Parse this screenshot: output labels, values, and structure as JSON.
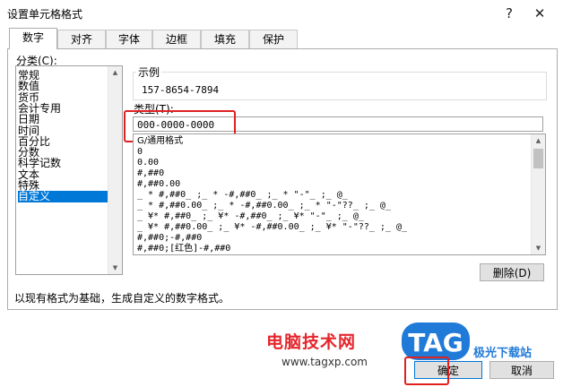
{
  "window": {
    "title": "设置单元格格式",
    "help_symbol": "?",
    "close_symbol": "✕"
  },
  "tabs": [
    {
      "label": "数字",
      "active": true
    },
    {
      "label": "对齐",
      "active": false
    },
    {
      "label": "字体",
      "active": false
    },
    {
      "label": "边框",
      "active": false
    },
    {
      "label": "填充",
      "active": false
    },
    {
      "label": "保护",
      "active": false
    }
  ],
  "category": {
    "label": "分类(C):",
    "items": [
      "常规",
      "数值",
      "货币",
      "会计专用",
      "日期",
      "时间",
      "百分比",
      "分数",
      "科学记数",
      "文本",
      "特殊",
      "自定义"
    ],
    "selected": "自定义"
  },
  "sample": {
    "label": "示例",
    "value": "157-8654-7894"
  },
  "type_field": {
    "label": "类型(T):",
    "value": "000-0000-0000"
  },
  "format_list": [
    "G/通用格式",
    "0",
    "0.00",
    "#,##0",
    "#,##0.00",
    "_ * #,##0_ ;_ * -#,##0_ ;_ * \"-\"_ ;_ @_",
    "_ * #,##0.00_ ;_ * -#,##0.00_ ;_ * \"-\"??_ ;_ @_",
    "_ ¥* #,##0_ ;_ ¥* -#,##0_ ;_ ¥* \"-\"_ ;_ @_",
    "_ ¥* #,##0.00_ ;_ ¥* -#,##0.00_ ;_ ¥* \"-\"??_ ;_ @_",
    "#,##0;-#,##0",
    "#,##0;[红色]-#,##0"
  ],
  "delete_button": "删除(D)",
  "description": "以现有格式为基础，生成自定义的数字格式。",
  "ok_button": "确定",
  "cancel_button": "取消",
  "watermark": {
    "text": "电脑技术网",
    "url": "www.tagxp.com",
    "logo": "TAG",
    "side_text": "极光下载站"
  },
  "colors": {
    "selection": "#0078d7",
    "highlight_box": "#e02020",
    "watermark_red": "#e5262d",
    "logo_blue": "#1f7ad8"
  }
}
